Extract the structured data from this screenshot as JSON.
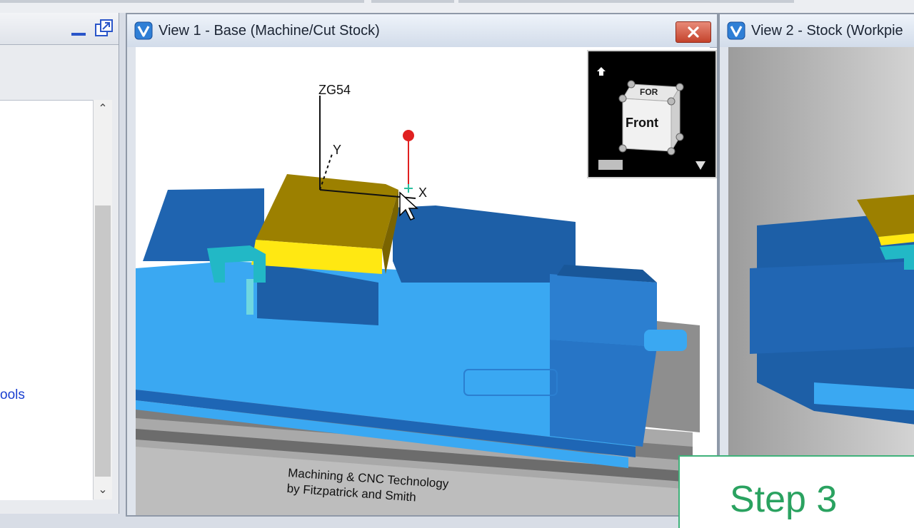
{
  "left_panel": {
    "tree_item_fragment": "ools"
  },
  "view1": {
    "title": "View 1 - Base (Machine/Cut Stock)",
    "cube_front": "Front",
    "cube_top": "FOR",
    "csys_label": "ZG54",
    "axis_y": "Y",
    "axis_x": "X",
    "credit_line1": "Machining & CNC Technology",
    "credit_line2": "by Fitzpatrick and Smith"
  },
  "view2": {
    "title": "View 2 - Stock (Workpie"
  },
  "step_badge": {
    "label": "Step 3"
  },
  "colors": {
    "vise_light": "#37a7f0",
    "vise_dark": "#1d5fa7",
    "stock_top": "#9c8000",
    "stock_side": "#ffe812",
    "clamp": "#22b8c6",
    "step_green": "#2aa260",
    "close_red": "#c4432c"
  },
  "icons": [
    "vericut-logo-icon",
    "close-icon",
    "minimize-icon",
    "restore-icon",
    "home-icon",
    "dropdown-arrow-icon",
    "mouse-cursor-icon"
  ]
}
